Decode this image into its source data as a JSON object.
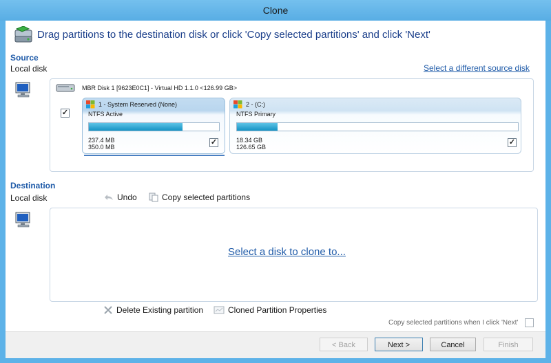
{
  "window": {
    "title": "Clone"
  },
  "header": {
    "instruction": "Drag partitions to the destination disk or click 'Copy selected partitions' and click 'Next'"
  },
  "source": {
    "title": "Source",
    "subtitle": "Local disk",
    "change_link": "Select a different source disk",
    "disk_label": "MBR Disk 1 [9623E0C1] - Virtual HD 1.1.0  <126.99 GB>",
    "partitions": [
      {
        "name": "1 - System Reserved (None)",
        "type": "NTFS Active",
        "used": "237.4 MB",
        "total": "350.0 MB",
        "fill": 0.72,
        "checked": true
      },
      {
        "name": "2 - (C:)",
        "type": "NTFS Primary",
        "used": "18.34 GB",
        "total": "126.65 GB",
        "fill": 0.145,
        "checked": true
      }
    ]
  },
  "destination": {
    "title": "Destination",
    "subtitle": "Local disk",
    "undo_label": "Undo",
    "copy_label": "Copy selected partitions",
    "select_link": "Select a disk to clone to..."
  },
  "actions": {
    "delete_label": "Delete Existing partition",
    "properties_label": "Cloned Partition Properties",
    "copy_on_next_label": "Copy selected partitions when I click 'Next'"
  },
  "buttons": {
    "back": "< Back",
    "next": "Next >",
    "cancel": "Cancel",
    "finish": "Finish"
  },
  "colors": {
    "accent": "#1e5aa8",
    "bar_fill": "#1593c4",
    "titlebar": "#5db2e8"
  }
}
